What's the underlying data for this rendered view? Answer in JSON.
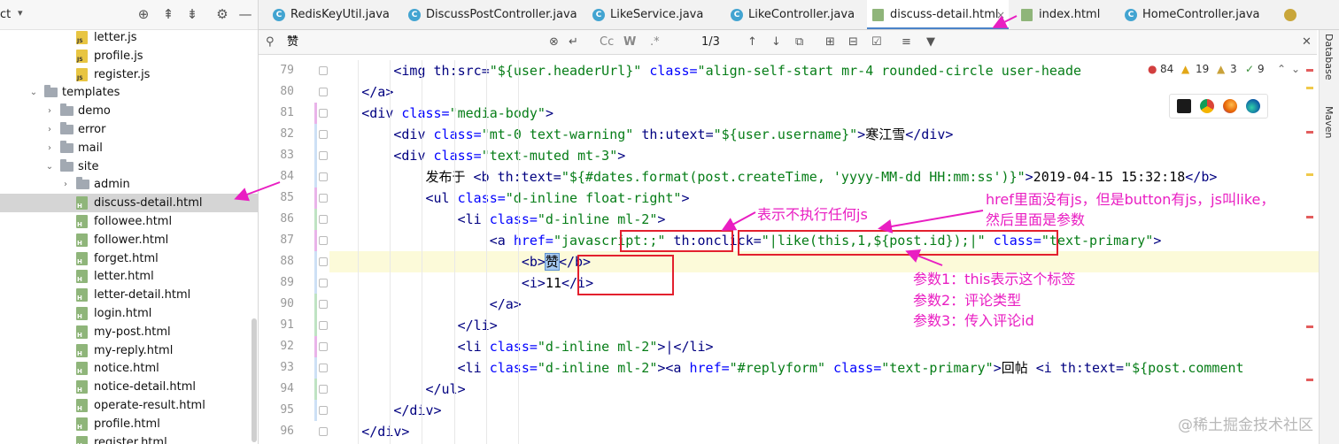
{
  "project_panel": {
    "title": "ct",
    "dropdown_icon": "chevron-down-icon",
    "header_icons": [
      "crosshair-icon",
      "collapse-all-icon",
      "expand-all-icon",
      "gear-icon",
      "hide-icon"
    ],
    "tree": [
      {
        "label": "letter.js",
        "type": "js",
        "depth": 3
      },
      {
        "label": "profile.js",
        "type": "js",
        "depth": 3
      },
      {
        "label": "register.js",
        "type": "js",
        "depth": 3
      },
      {
        "label": "templates",
        "type": "folder",
        "depth": 1,
        "expanded": true
      },
      {
        "label": "demo",
        "type": "folder",
        "depth": 2,
        "expanded": false
      },
      {
        "label": "error",
        "type": "folder",
        "depth": 2,
        "expanded": false
      },
      {
        "label": "mail",
        "type": "folder",
        "depth": 2,
        "expanded": false
      },
      {
        "label": "site",
        "type": "folder",
        "depth": 2,
        "expanded": true
      },
      {
        "label": "admin",
        "type": "folder",
        "depth": 3,
        "expanded": false
      },
      {
        "label": "discuss-detail.html",
        "type": "html",
        "depth": 3,
        "selected": true
      },
      {
        "label": "followee.html",
        "type": "html",
        "depth": 3
      },
      {
        "label": "follower.html",
        "type": "html",
        "depth": 3
      },
      {
        "label": "forget.html",
        "type": "html",
        "depth": 3
      },
      {
        "label": "letter.html",
        "type": "html",
        "depth": 3
      },
      {
        "label": "letter-detail.html",
        "type": "html",
        "depth": 3
      },
      {
        "label": "login.html",
        "type": "html",
        "depth": 3
      },
      {
        "label": "my-post.html",
        "type": "html",
        "depth": 3
      },
      {
        "label": "my-reply.html",
        "type": "html",
        "depth": 3
      },
      {
        "label": "notice.html",
        "type": "html",
        "depth": 3
      },
      {
        "label": "notice-detail.html",
        "type": "html",
        "depth": 3
      },
      {
        "label": "operate-result.html",
        "type": "html",
        "depth": 3
      },
      {
        "label": "profile.html",
        "type": "html",
        "depth": 3
      },
      {
        "label": "register.html",
        "type": "html",
        "depth": 3
      }
    ]
  },
  "tabs": [
    {
      "label": "RedisKeyUtil.java",
      "kind": "java"
    },
    {
      "label": "DiscussPostController.java",
      "kind": "java"
    },
    {
      "label": "LikeService.java",
      "kind": "java"
    },
    {
      "label": "LikeController.java",
      "kind": "java"
    },
    {
      "label": "discuss-detail.html",
      "kind": "html",
      "active": true,
      "close": "×"
    },
    {
      "label": "index.html",
      "kind": "html"
    },
    {
      "label": "HomeController.java",
      "kind": "java"
    }
  ],
  "search": {
    "query": "赞",
    "match_case": "Cc",
    "words": "W",
    "regex": ".*",
    "count": "1/3"
  },
  "inspections": {
    "errors": "84",
    "warnings": "19",
    "weak_warnings": "3",
    "typos": "9"
  },
  "right_strip": {
    "database": "Database",
    "maven": "Maven"
  },
  "code_lines": [
    {
      "n": "79",
      "indent": 3,
      "segments": [
        [
          "tag",
          "<img "
        ],
        [
          "th",
          "th:src="
        ],
        [
          "val",
          "\"${user.headerUrl}\""
        ],
        [
          "attr",
          " class="
        ],
        [
          "val",
          "\"align-self-start mr-4 rounded-circle user-heade"
        ]
      ]
    },
    {
      "n": "80",
      "indent": 2,
      "segments": [
        [
          "tag",
          "</a>"
        ]
      ]
    },
    {
      "n": "81",
      "indent": 2,
      "segments": [
        [
          "tag",
          "<div "
        ],
        [
          "attr",
          "class="
        ],
        [
          "val",
          "\"media-body\""
        ],
        [
          "tag",
          ">"
        ]
      ]
    },
    {
      "n": "82",
      "indent": 3,
      "segments": [
        [
          "tag",
          "<div "
        ],
        [
          "attr",
          "class="
        ],
        [
          "val",
          "\"mt-0 text-warning\""
        ],
        [
          "th",
          " th:utext="
        ],
        [
          "val",
          "\"${user.username}\""
        ],
        [
          "tag",
          ">"
        ],
        [
          "plain",
          "寒江雪"
        ],
        [
          "tag",
          "</div>"
        ]
      ]
    },
    {
      "n": "83",
      "indent": 3,
      "segments": [
        [
          "tag",
          "<div "
        ],
        [
          "attr",
          "class="
        ],
        [
          "val",
          "\"text-muted mt-3\""
        ],
        [
          "tag",
          ">"
        ]
      ]
    },
    {
      "n": "84",
      "indent": 4,
      "segments": [
        [
          "plain",
          "发布于 "
        ],
        [
          "tag",
          "<b "
        ],
        [
          "th",
          "th:text="
        ],
        [
          "val",
          "\"${#dates.format(post.createTime, 'yyyy-MM-dd HH:mm:ss')}\""
        ],
        [
          "tag",
          ">"
        ],
        [
          "plain",
          "2019-04-15 15:32:18"
        ],
        [
          "tag",
          "</b>"
        ]
      ]
    },
    {
      "n": "85",
      "indent": 4,
      "segments": [
        [
          "tag",
          "<ul "
        ],
        [
          "attr",
          "class="
        ],
        [
          "val",
          "\"d-inline float-right\""
        ],
        [
          "tag",
          ">"
        ]
      ]
    },
    {
      "n": "86",
      "indent": 5,
      "segments": [
        [
          "tag",
          "<li "
        ],
        [
          "attr",
          "class="
        ],
        [
          "val",
          "\"d-inline ml-2\""
        ],
        [
          "tag",
          ">"
        ]
      ]
    },
    {
      "n": "87",
      "indent": 6,
      "segments": [
        [
          "tag",
          "<a "
        ],
        [
          "attr",
          "href="
        ],
        [
          "val",
          "\"javascript:;\""
        ],
        [
          "th",
          " th:onclick="
        ],
        [
          "val",
          "\"|like(this,1,${post.id});|\""
        ],
        [
          "attr",
          " class="
        ],
        [
          "val",
          "\"text-primary\""
        ],
        [
          "tag",
          ">"
        ]
      ]
    },
    {
      "n": "88",
      "indent": 7,
      "highlight": true,
      "segments": [
        [
          "tag",
          "<b>"
        ],
        [
          "plain",
          "赞"
        ],
        [
          "tag",
          "</b>"
        ]
      ]
    },
    {
      "n": "89",
      "indent": 7,
      "segments": [
        [
          "tag",
          "<i>"
        ],
        [
          "plain",
          "11"
        ],
        [
          "tag",
          "</i>"
        ]
      ]
    },
    {
      "n": "90",
      "indent": 6,
      "segments": [
        [
          "tag",
          "</a>"
        ]
      ]
    },
    {
      "n": "91",
      "indent": 5,
      "segments": [
        [
          "tag",
          "</li>"
        ]
      ]
    },
    {
      "n": "92",
      "indent": 5,
      "segments": [
        [
          "tag",
          "<li "
        ],
        [
          "attr",
          "class="
        ],
        [
          "val",
          "\"d-inline ml-2\""
        ],
        [
          "tag",
          ">|</li>"
        ]
      ]
    },
    {
      "n": "93",
      "indent": 5,
      "segments": [
        [
          "tag",
          "<li "
        ],
        [
          "attr",
          "class="
        ],
        [
          "val",
          "\"d-inline ml-2\""
        ],
        [
          "tag",
          "><a "
        ],
        [
          "attr",
          "href="
        ],
        [
          "val",
          "\"#replyform\""
        ],
        [
          "attr",
          " class="
        ],
        [
          "val",
          "\"text-primary\""
        ],
        [
          "tag",
          ">"
        ],
        [
          "plain",
          "回帖 "
        ],
        [
          "tag",
          "<i "
        ],
        [
          "th",
          "th:text="
        ],
        [
          "val",
          "\"${post.comment"
        ]
      ]
    },
    {
      "n": "94",
      "indent": 4,
      "segments": [
        [
          "tag",
          "</ul>"
        ]
      ]
    },
    {
      "n": "95",
      "indent": 3,
      "segments": [
        [
          "tag",
          "</div>"
        ]
      ]
    },
    {
      "n": "96",
      "indent": 2,
      "segments": [
        [
          "tag",
          "</div>"
        ]
      ]
    }
  ],
  "annotations": {
    "no_js": "表示不执行任何js",
    "href_note_1": "href里面没有js，但是button有js，js叫like，",
    "href_note_2": "然后里面是参数",
    "param1": "参数1：this表示这个标签",
    "param2": "参数2：评论类型",
    "param3": "参数3：传入评论id"
  },
  "watermark": "@稀土掘金技术社区",
  "colors": {
    "annotation_text": "#e91ec2",
    "annotation_box": "#e3202e",
    "tag": "#000080",
    "attr": "#0000ff",
    "value": "#067d17",
    "active_tab_underline": "#4a83c8"
  }
}
